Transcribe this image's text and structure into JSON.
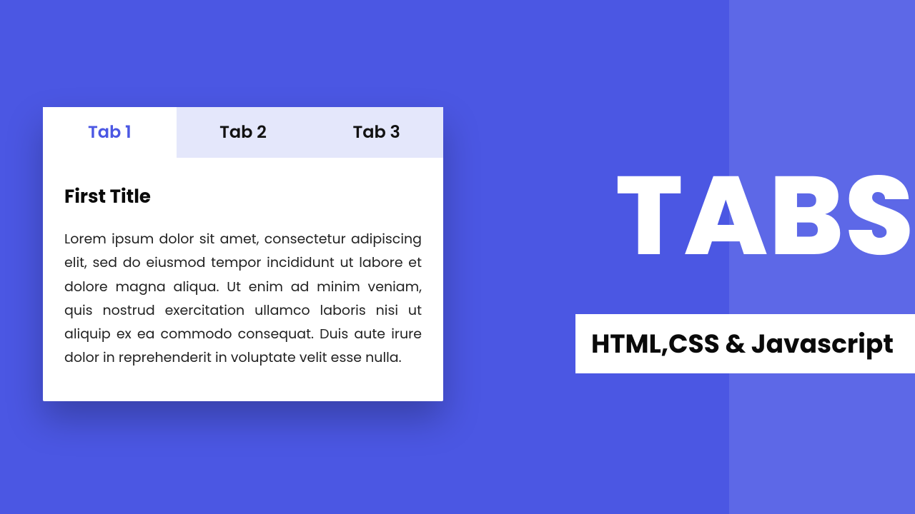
{
  "tabs": [
    {
      "label": "Tab 1",
      "active": true
    },
    {
      "label": "Tab 2",
      "active": false
    },
    {
      "label": "Tab 3",
      "active": false
    }
  ],
  "content": {
    "title": "First Title",
    "body": "Lorem ipsum dolor sit amet, consectetur adipiscing elit, sed do eiusmod tempor incididunt ut labore et dolore magna aliqua. Ut enim ad minim veniam, quis nostrud exercitation ullamco laboris nisi ut aliquip ex ea commodo consequat. Duis aute irure dolor in reprehenderit in voluptate velit esse nulla."
  },
  "hero": {
    "title": "TABS",
    "subtitle": "HTML,CSS & Javascript"
  }
}
